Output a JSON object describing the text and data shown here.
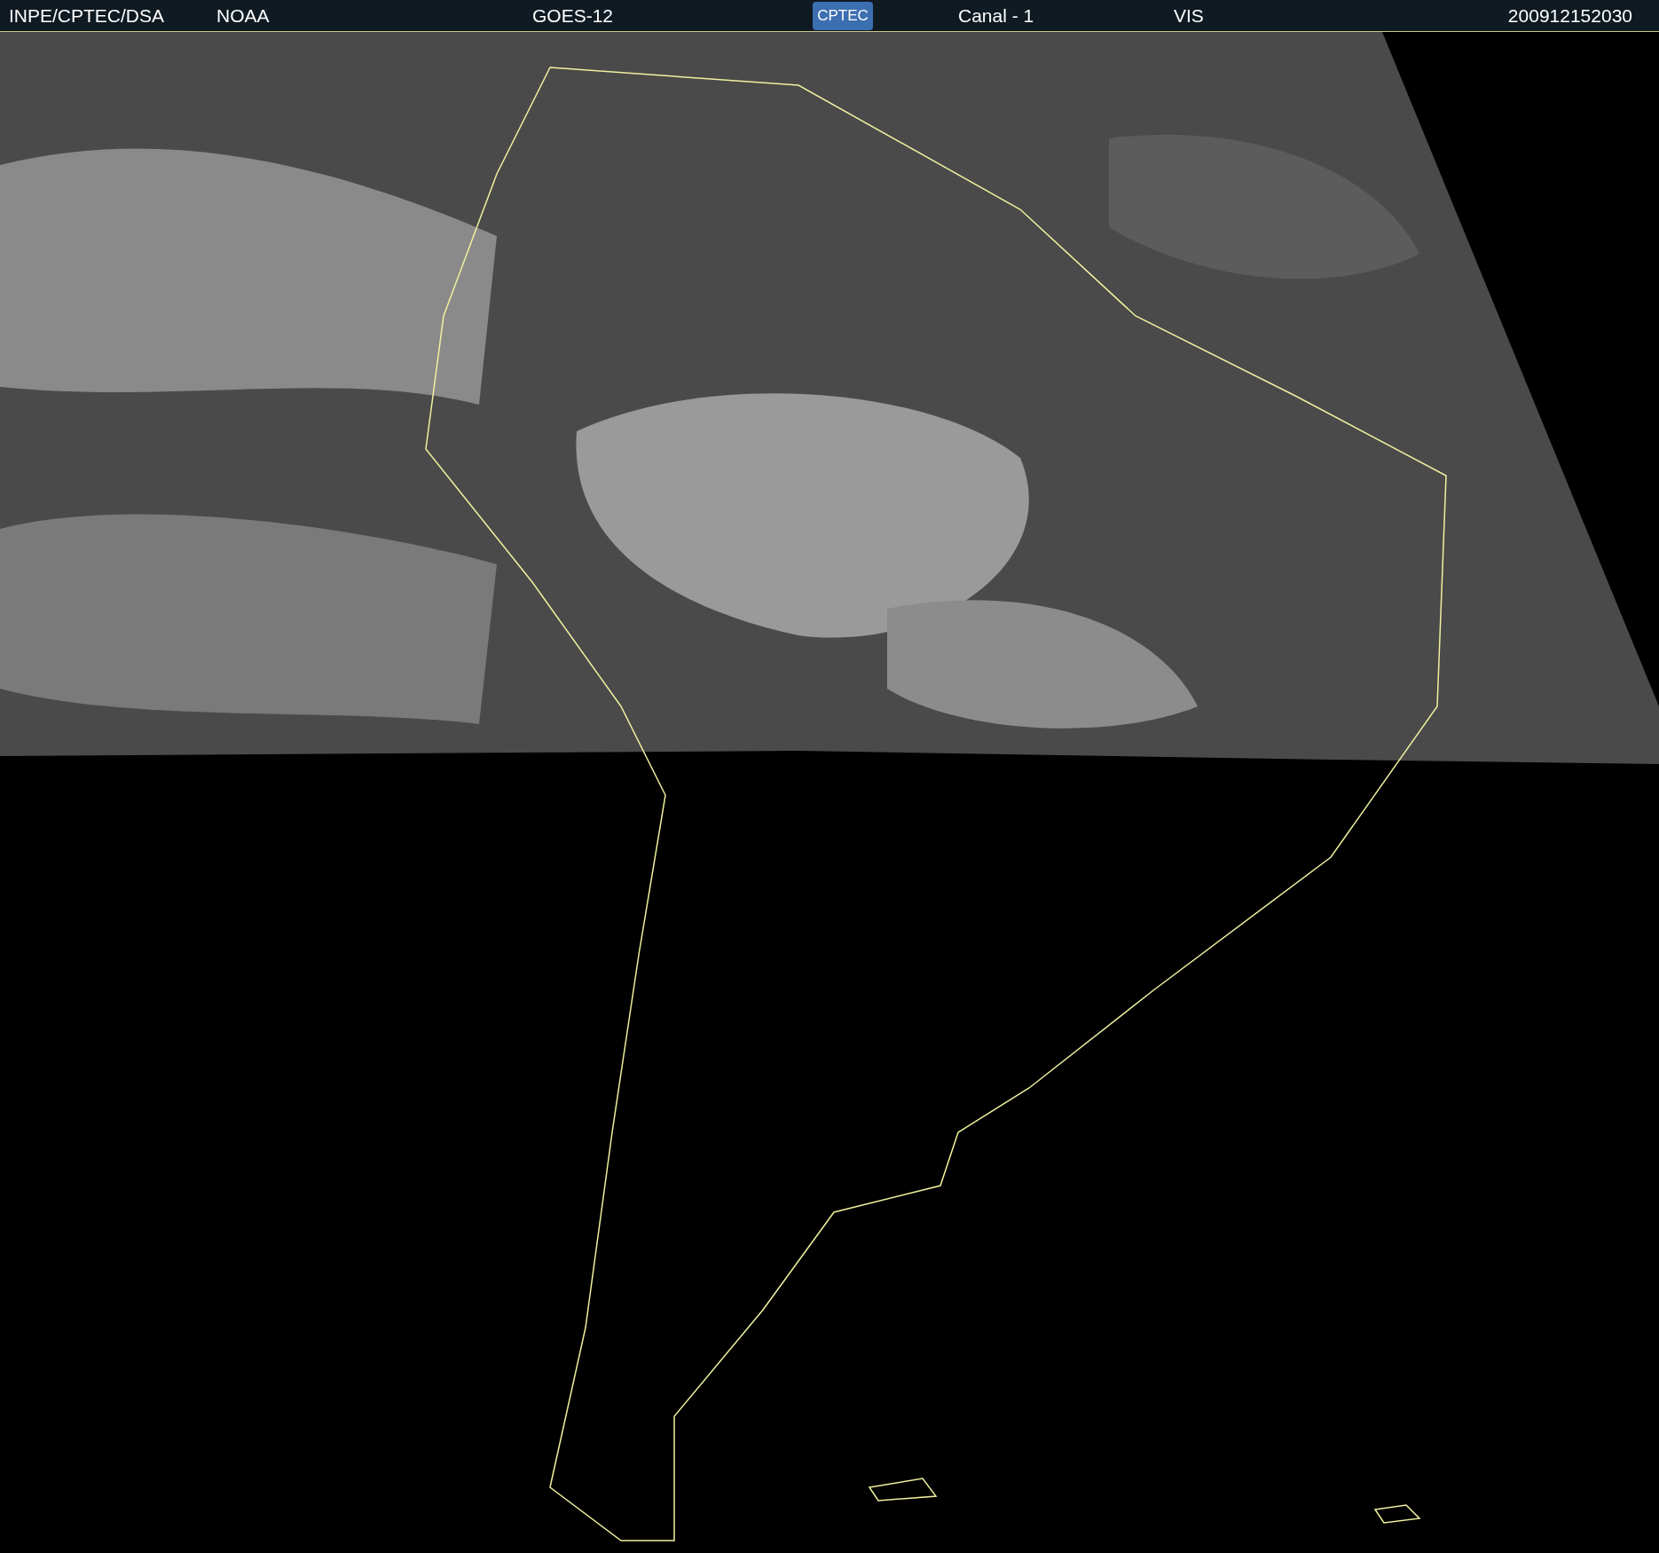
{
  "header": {
    "source": "INPE/CPTEC/DSA",
    "agency": "NOAA",
    "satellite": "GOES-12",
    "logo": "CPTEC",
    "channel": "Canal - 1",
    "band": "VIS",
    "timestamp": "200912152030"
  }
}
